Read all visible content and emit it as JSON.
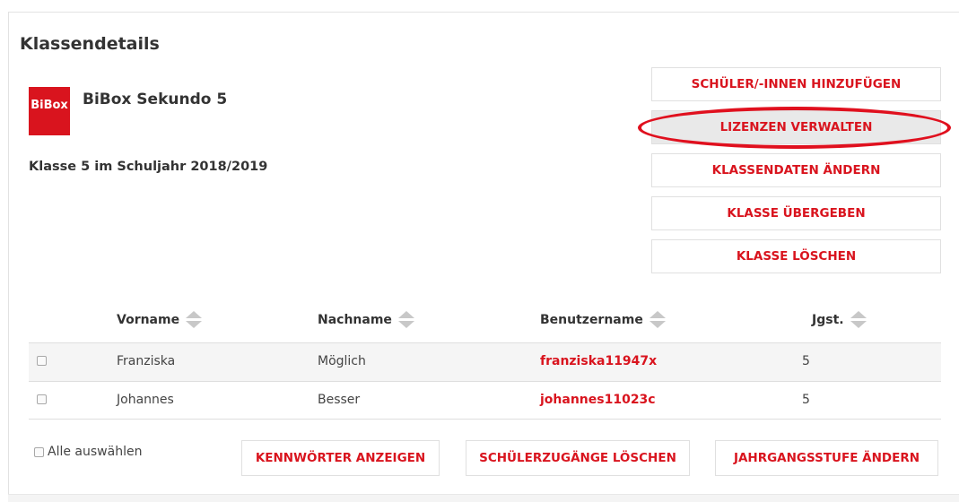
{
  "page": {
    "title": "Klassendetails"
  },
  "product": {
    "logo_text": "BiBox",
    "name": "BiBox Sekundo 5",
    "logo_color": "#d9141e"
  },
  "class_info": "Klasse 5 im Schuljahr 2018/2019",
  "actions": [
    {
      "label": "SCHÜLER/-INNEN HINZUFÜGEN",
      "highlighted": false
    },
    {
      "label": "LIZENZEN VERWALTEN",
      "highlighted": true
    },
    {
      "label": "KLASSENDATEN ÄNDERN",
      "highlighted": false
    },
    {
      "label": "KLASSE ÜBERGEBEN",
      "highlighted": false
    },
    {
      "label": "KLASSE LÖSCHEN",
      "highlighted": false
    }
  ],
  "table": {
    "columns": [
      "Vorname",
      "Nachname",
      "Benutzername",
      "Jgst."
    ],
    "rows": [
      {
        "vorname": "Franziska",
        "nachname": "Möglich",
        "benutzername": "franziska11947x",
        "jgst": "5"
      },
      {
        "vorname": "Johannes",
        "nachname": "Besser",
        "benutzername": "johannes11023c",
        "jgst": "5"
      }
    ]
  },
  "footer": {
    "select_all": "Alle auswählen",
    "buttons": [
      "KENNWÖRTER ANZEIGEN",
      "SCHÜLERZUGÄNGE LÖSCHEN",
      "JAHRGANGSSTUFE ÄNDERN"
    ]
  },
  "colors": {
    "accent": "#d9141e",
    "highlight_ring": "#e0101e"
  }
}
